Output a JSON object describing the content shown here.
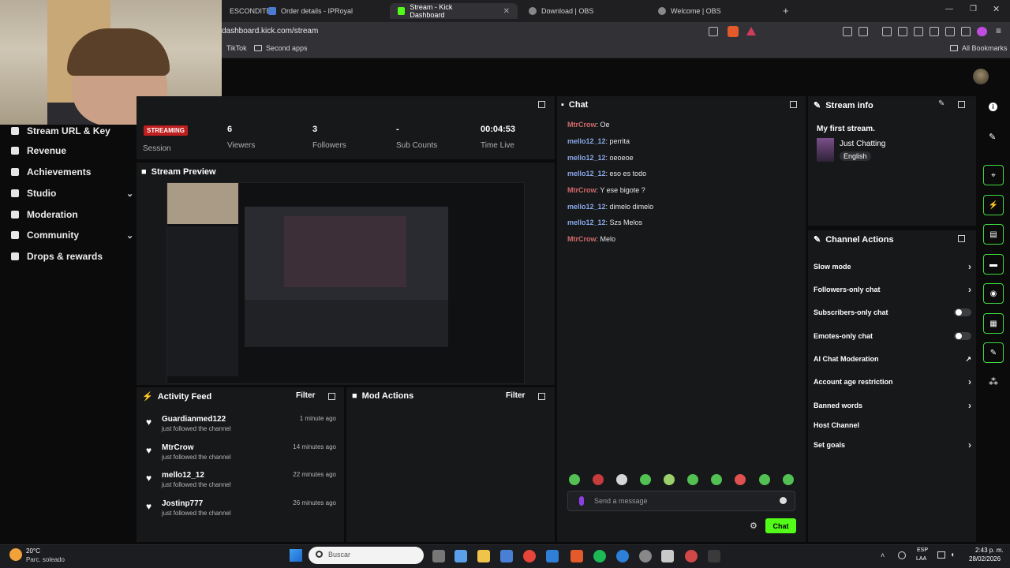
{
  "browser": {
    "tabs": [
      {
        "label": "ESCONDITE"
      },
      {
        "label": "Order details - IPRoyal"
      },
      {
        "label": "Stream - Kick Dashboard"
      },
      {
        "label": "Download | OBS"
      },
      {
        "label": "Welcome | OBS"
      }
    ],
    "url": "dashboard.kick.com/stream",
    "bookmarks": [
      "TikTok",
      "Second apps"
    ],
    "all_bookmarks": "All Bookmarks"
  },
  "sidebar": {
    "items": [
      {
        "label": "Stream URL & Key"
      },
      {
        "label": "Revenue"
      },
      {
        "label": "Achievements"
      },
      {
        "label": "Studio"
      },
      {
        "label": "Moderation"
      },
      {
        "label": "Community"
      },
      {
        "label": "Drops & rewards"
      }
    ]
  },
  "stats": {
    "badge": "STREAMING",
    "session": "Session",
    "viewers_value": "6",
    "viewers_label": "Viewers",
    "followers_value": "3",
    "followers_label": "Followers",
    "subs_value": "-",
    "subs_label": "Sub Counts",
    "time_value": "00:04:53",
    "time_label": "Time Live"
  },
  "preview": {
    "title": "Stream Preview"
  },
  "activity": {
    "title": "Activity Feed",
    "filter": "Filter",
    "items": [
      {
        "name": "Guardianmed122",
        "action": "just followed the channel",
        "time": "1 minute ago"
      },
      {
        "name": "MtrCrow",
        "action": "just followed the channel",
        "time": "14 minutes ago"
      },
      {
        "name": "mello12_12",
        "action": "just followed the channel",
        "time": "22 minutes ago"
      },
      {
        "name": "Jostinp777",
        "action": "just followed the channel",
        "time": "26 minutes ago"
      }
    ]
  },
  "mod": {
    "title": "Mod Actions",
    "filter": "Filter"
  },
  "chat": {
    "title": "Chat",
    "messages": [
      {
        "user": "MtrCrow",
        "text": ": Oe"
      },
      {
        "user": "mello12_12",
        "text": ": perrita"
      },
      {
        "user": "mello12_12",
        "text": ": oeoeoe"
      },
      {
        "user": "mello12_12",
        "text": ": eso es todo"
      },
      {
        "user": "MtrCrow",
        "text": ": Y ese bigote ?"
      },
      {
        "user": "mello12_12",
        "text": ": dimelo dimelo"
      },
      {
        "user": "mello12_12",
        "text": ": Szs Melos"
      },
      {
        "user": "MtrCrow",
        "text": ": Melo"
      }
    ],
    "placeholder": "Send a message",
    "send": "Chat"
  },
  "stream_info": {
    "title": "Stream info",
    "stream_title": "My first stream.",
    "category": "Just Chatting",
    "language": "English"
  },
  "channel_actions": {
    "title": "Channel Actions",
    "items": [
      {
        "label": "Slow mode"
      },
      {
        "label": "Followers-only chat"
      },
      {
        "label": "Subscribers-only chat"
      },
      {
        "label": "Emotes-only chat"
      },
      {
        "label": "AI Chat Moderation"
      },
      {
        "label": "Account age restriction"
      },
      {
        "label": "Banned words"
      },
      {
        "label": "Host Channel"
      },
      {
        "label": "Set goals"
      }
    ]
  },
  "taskbar": {
    "weather_temp": "20°C",
    "weather_desc": "Parc. soleado",
    "search": "Buscar",
    "lang": "ESP",
    "lang2": "LAA",
    "time": "2:43 p. m.",
    "date": "28/02/2026"
  },
  "colors": {
    "accent": "#53fc18",
    "streaming": "#c01f1f"
  }
}
